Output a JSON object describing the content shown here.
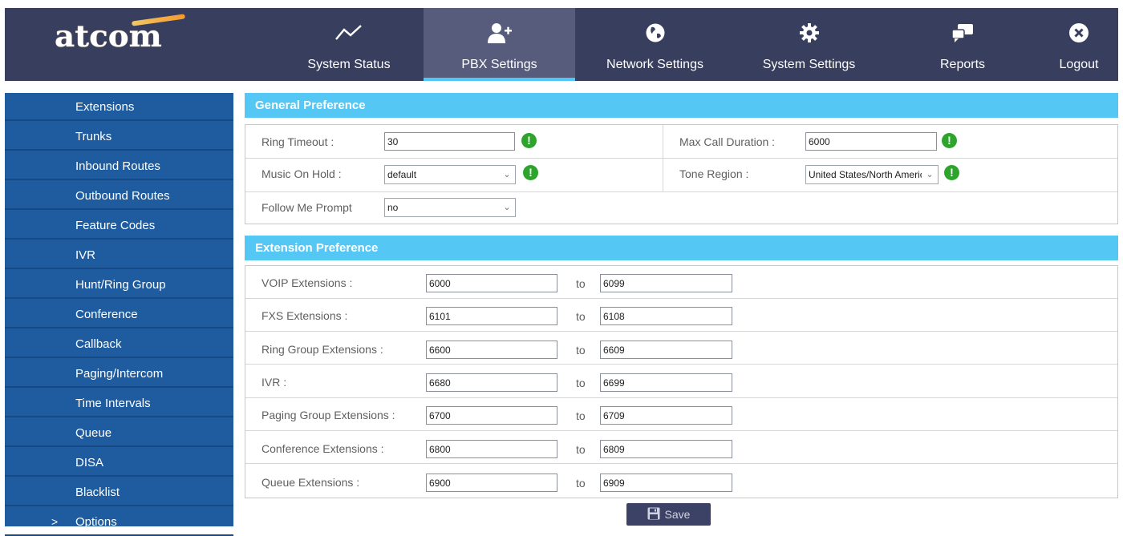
{
  "brand": {
    "logo_text": "atcom"
  },
  "nav": {
    "items": [
      {
        "label": "System Status",
        "icon": "trend-line-icon"
      },
      {
        "label": "PBX Settings",
        "icon": "add-user-icon",
        "active": true
      },
      {
        "label": "Network Settings",
        "icon": "globe-icon"
      },
      {
        "label": "System Settings",
        "icon": "gear-icon"
      },
      {
        "label": "Reports",
        "icon": "chat-bubbles-icon"
      },
      {
        "label": "Logout",
        "icon": "close-circle-icon"
      }
    ]
  },
  "sidebar": {
    "items": [
      {
        "label": "Extensions"
      },
      {
        "label": "Trunks"
      },
      {
        "label": "Inbound Routes"
      },
      {
        "label": "Outbound Routes"
      },
      {
        "label": "Feature Codes"
      },
      {
        "label": "IVR"
      },
      {
        "label": "Hunt/Ring Group"
      },
      {
        "label": "Conference"
      },
      {
        "label": "Callback"
      },
      {
        "label": "Paging/Intercom"
      },
      {
        "label": "Time Intervals"
      },
      {
        "label": "Queue"
      },
      {
        "label": "DISA"
      },
      {
        "label": "Blacklist"
      },
      {
        "label": "Options",
        "chevron": ">"
      }
    ]
  },
  "general": {
    "title": "General Preference",
    "ring_timeout": {
      "label": "Ring Timeout :",
      "value": "30"
    },
    "max_call_duration": {
      "label": "Max Call Duration :",
      "value": "6000"
    },
    "music_on_hold": {
      "label": "Music On Hold :",
      "value": "default"
    },
    "tone_region": {
      "label": "Tone Region :",
      "value": "United States/North America"
    },
    "follow_me_prompt": {
      "label": "Follow Me Prompt",
      "value": "no"
    }
  },
  "extension": {
    "title": "Extension Preference",
    "to_label": "to",
    "rows": [
      {
        "label": "VOIP Extensions :",
        "from": "6000",
        "to": "6099"
      },
      {
        "label": "FXS Extensions :",
        "from": "6101",
        "to": "6108"
      },
      {
        "label": "Ring Group Extensions :",
        "from": "6600",
        "to": "6609"
      },
      {
        "label": "IVR :",
        "from": "6680",
        "to": "6699"
      },
      {
        "label": "Paging Group Extensions :",
        "from": "6700",
        "to": "6709"
      },
      {
        "label": "Conference Extensions :",
        "from": "6800",
        "to": "6809"
      },
      {
        "label": "Queue Extensions :",
        "from": "6900",
        "to": "6909"
      }
    ]
  },
  "save_label": "Save",
  "colors": {
    "topbar": "#383e5e",
    "accent": "#55c7f5",
    "sidebar": "#1e5c9f",
    "warn": "#2da52d"
  }
}
